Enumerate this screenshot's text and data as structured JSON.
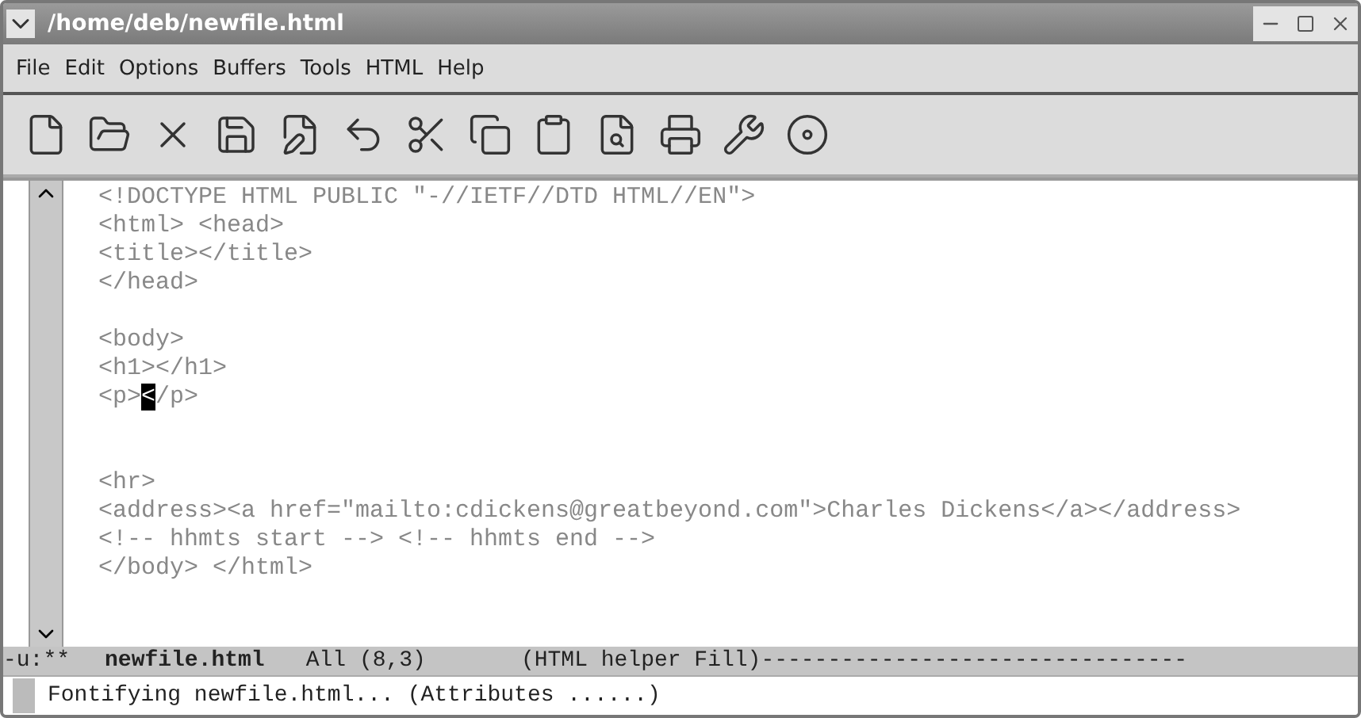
{
  "window": {
    "title": "/home/deb/newfile.html"
  },
  "menu": [
    "File",
    "Edit",
    "Options",
    "Buffers",
    "Tools",
    "HTML",
    "Help"
  ],
  "toolbar": [
    {
      "kind": "new"
    },
    {
      "kind": "open"
    },
    {
      "kind": "close"
    },
    {
      "kind": "save"
    },
    {
      "kind": "saveas"
    },
    {
      "kind": "undo"
    },
    {
      "kind": "cut"
    },
    {
      "kind": "copy"
    },
    {
      "kind": "paste"
    },
    {
      "kind": "search"
    },
    {
      "kind": "print"
    },
    {
      "kind": "tools"
    },
    {
      "kind": "help"
    }
  ],
  "blocks": [
    {
      "kind": "top",
      "lines": [
        {
          "text": "<!DOCTYPE HTML PUBLIC \"-//IETF//DTD HTML//EN\">"
        },
        {
          "text": "<html> <head>"
        },
        {
          "text": "<title></title>"
        },
        {
          "text": "</head>"
        }
      ]
    },
    {
      "kind": "spaced",
      "lines": [
        {
          "text": "<body>"
        },
        {
          "text": "<h1></h1>"
        },
        {
          "text": "<p>",
          "cursor": "<",
          "after": "/p>"
        }
      ]
    },
    {
      "kind": "wide",
      "lines": [
        {
          "text": "<hr>"
        },
        {
          "text": "<address><a href=\"mailto:cdickens@greatbeyond.com\">Charles Dickens</a></address>"
        },
        {
          "text": "<!-- hhmts start --> <!-- hhmts end -->"
        },
        {
          "text": "</body> </html>"
        }
      ]
    }
  ],
  "mode_line": {
    "flags": "-u:**",
    "buffer": "newfile.html",
    "position": "All (8,3)",
    "mode": "(HTML helper Fill)",
    "trailer": "--------------------------------"
  },
  "minibuffer": "Fontifying newfile.html... (Attributes ......)"
}
